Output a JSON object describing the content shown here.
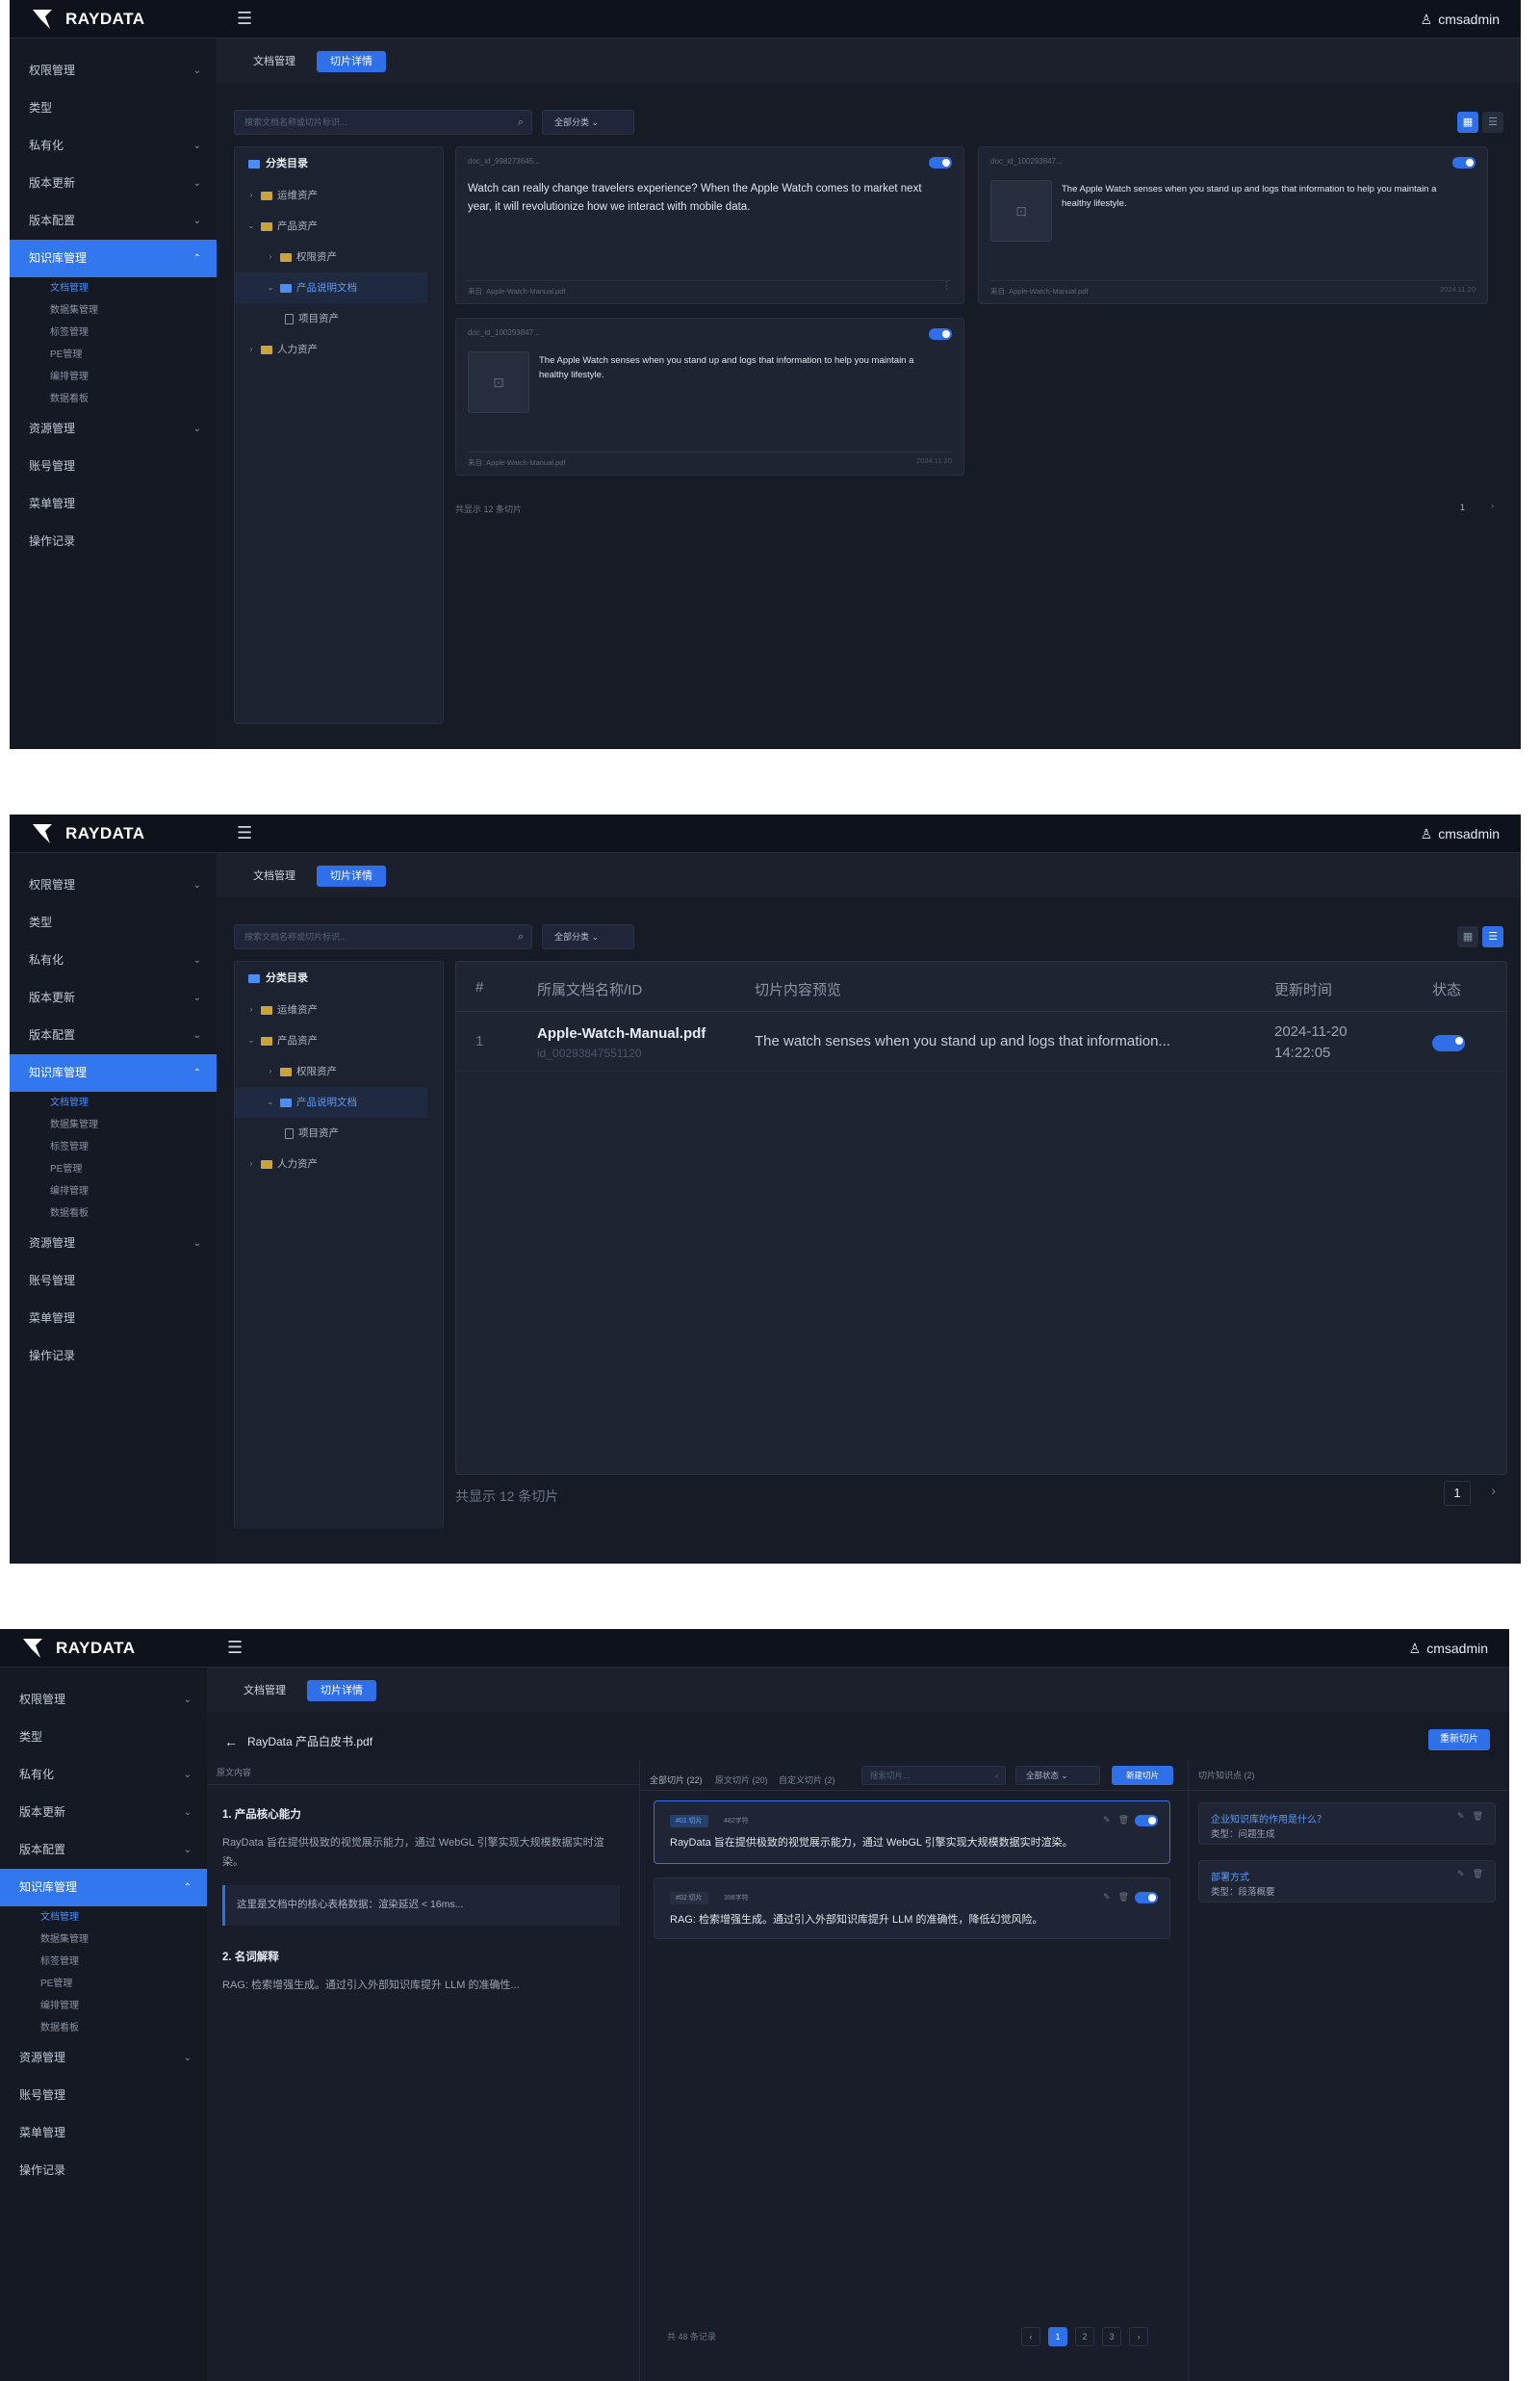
{
  "app": {
    "logo_text": "RAYDATA",
    "user": "cmsadmin",
    "menu_icon": "☰",
    "user_icon": "♙"
  },
  "sidebar": {
    "items": [
      {
        "label": "权限管理",
        "chev": "⌄"
      },
      {
        "label": "类型",
        "chev": ""
      },
      {
        "label": "私有化",
        "chev": "⌄"
      },
      {
        "label": "版本更新",
        "chev": "⌄"
      },
      {
        "label": "版本配置",
        "chev": "⌄"
      },
      {
        "label": "知识库管理",
        "chev": "⌃"
      }
    ],
    "sub_items": [
      "文档管理",
      "数据集管理",
      "标签管理",
      "PE管理",
      "编排管理",
      "数据看板"
    ],
    "items_after": [
      {
        "label": "资源管理",
        "chev": "⌄"
      },
      {
        "label": "账号管理",
        "chev": ""
      },
      {
        "label": "菜单管理",
        "chev": ""
      },
      {
        "label": "操作记录",
        "chev": ""
      }
    ]
  },
  "tabs": [
    "文档管理",
    "切片详情"
  ],
  "toolbar": {
    "search_placeholder": "搜索文档名称或切片标识...",
    "category_select": "全部分类",
    "search_icon": "⌕",
    "select_chev": "⌄"
  },
  "tree": {
    "title": "分类目录",
    "nodes": [
      {
        "label": "运维资产",
        "chev": "›"
      },
      {
        "label": "产品资产",
        "chev": "⌄"
      },
      {
        "label": "权限资产",
        "chev": "›"
      },
      {
        "label": "产品说明文档",
        "chev": "⌄"
      },
      {
        "label": "项目资产",
        "chev": ""
      },
      {
        "label": "人力资产",
        "chev": "›"
      }
    ]
  },
  "cards": [
    {
      "id": "doc_id_998273645...",
      "text": "Watch can really change travelers experience? When the Apple Watch comes to market next year, it will revolutionize how we interact with mobile data.",
      "source": "来自: Apple-Watch-Manual.pdf",
      "date": "",
      "more": "⋮"
    },
    {
      "id": "doc_id_100293847...",
      "text": "The Apple Watch senses when you stand up and logs that information to help you maintain a healthy lifestyle.",
      "source": "来自: Apple-Watch-Manual.pdf",
      "date": "2024.11.20"
    },
    {
      "id": "doc_id_100293847...",
      "text": "The Apple Watch senses when you stand up and logs that information to help you maintain a healthy lifestyle.",
      "source": "来自: Apple-Watch-Manual.pdf",
      "date": "2024.11.20"
    }
  ],
  "footer": {
    "total": "共显示 12 条切片",
    "page": "1",
    "next": "›"
  },
  "table": {
    "headers": [
      "#",
      "所属文档名称/ID",
      "切片内容预览",
      "更新时间",
      "状态"
    ],
    "rows": [
      {
        "index": "1",
        "doc_name": "Apple-Watch-Manual.pdf",
        "doc_id": "id_00293847551120",
        "preview": "The watch senses when you stand up and logs that information...",
        "date": "2024-11-20",
        "time": "14:22:05"
      }
    ]
  },
  "detail": {
    "back_icon": "←",
    "doc_title": "RayData 产品白皮书.pdf",
    "regen_button": "重新切片",
    "left": {
      "header": "原文内容",
      "sec1_title": "1. 产品核心能力",
      "sec1_text": "RayData 旨在提供极致的视觉展示能力，通过 WebGL 引擎实现大规模数据实时渲染。",
      "quote": "这里是文档中的核心表格数据：渲染延迟 < 16ms...",
      "sec2_title": "2. 名词解释",
      "sec2_text": "RAG: 检索增强生成。通过引入外部知识库提升 LLM 的准确性..."
    },
    "middle": {
      "tab_all": "全部切片 (22)",
      "tab_raw": "原文切片 (20)",
      "tab_custom": "自定义切片 (2)",
      "search_placeholder": "搜索切片...",
      "status_select": "全部状态",
      "new_button": "新建切片",
      "chunks": [
        {
          "badge": "#01 切片",
          "chars": "482字符",
          "text": "RayData 旨在提供极致的视觉展示能力，通过 WebGL 引擎实现大规模数据实时渲染。"
        },
        {
          "badge": "#02 切片",
          "chars": "398字符",
          "text": "RAG: 检索增强生成。通过引入外部知识库提升 LLM 的准确性，降低幻觉风险。"
        }
      ],
      "edit_icon": "✎",
      "delete_icon": "🗑",
      "total": "共 48 条记录",
      "pages": [
        "‹",
        "1",
        "2",
        "3",
        "›"
      ]
    },
    "right": {
      "header": "切片知识点 (2)",
      "items": [
        {
          "question": "企业知识库的作用是什么？",
          "type": "类型：问题生成"
        },
        {
          "question": "部署方式",
          "type": "类型：段落概要"
        }
      ]
    }
  },
  "colors": {
    "accent": "#2f6fe8",
    "bg": "#1a1f2b",
    "folder": "#caa33a"
  }
}
